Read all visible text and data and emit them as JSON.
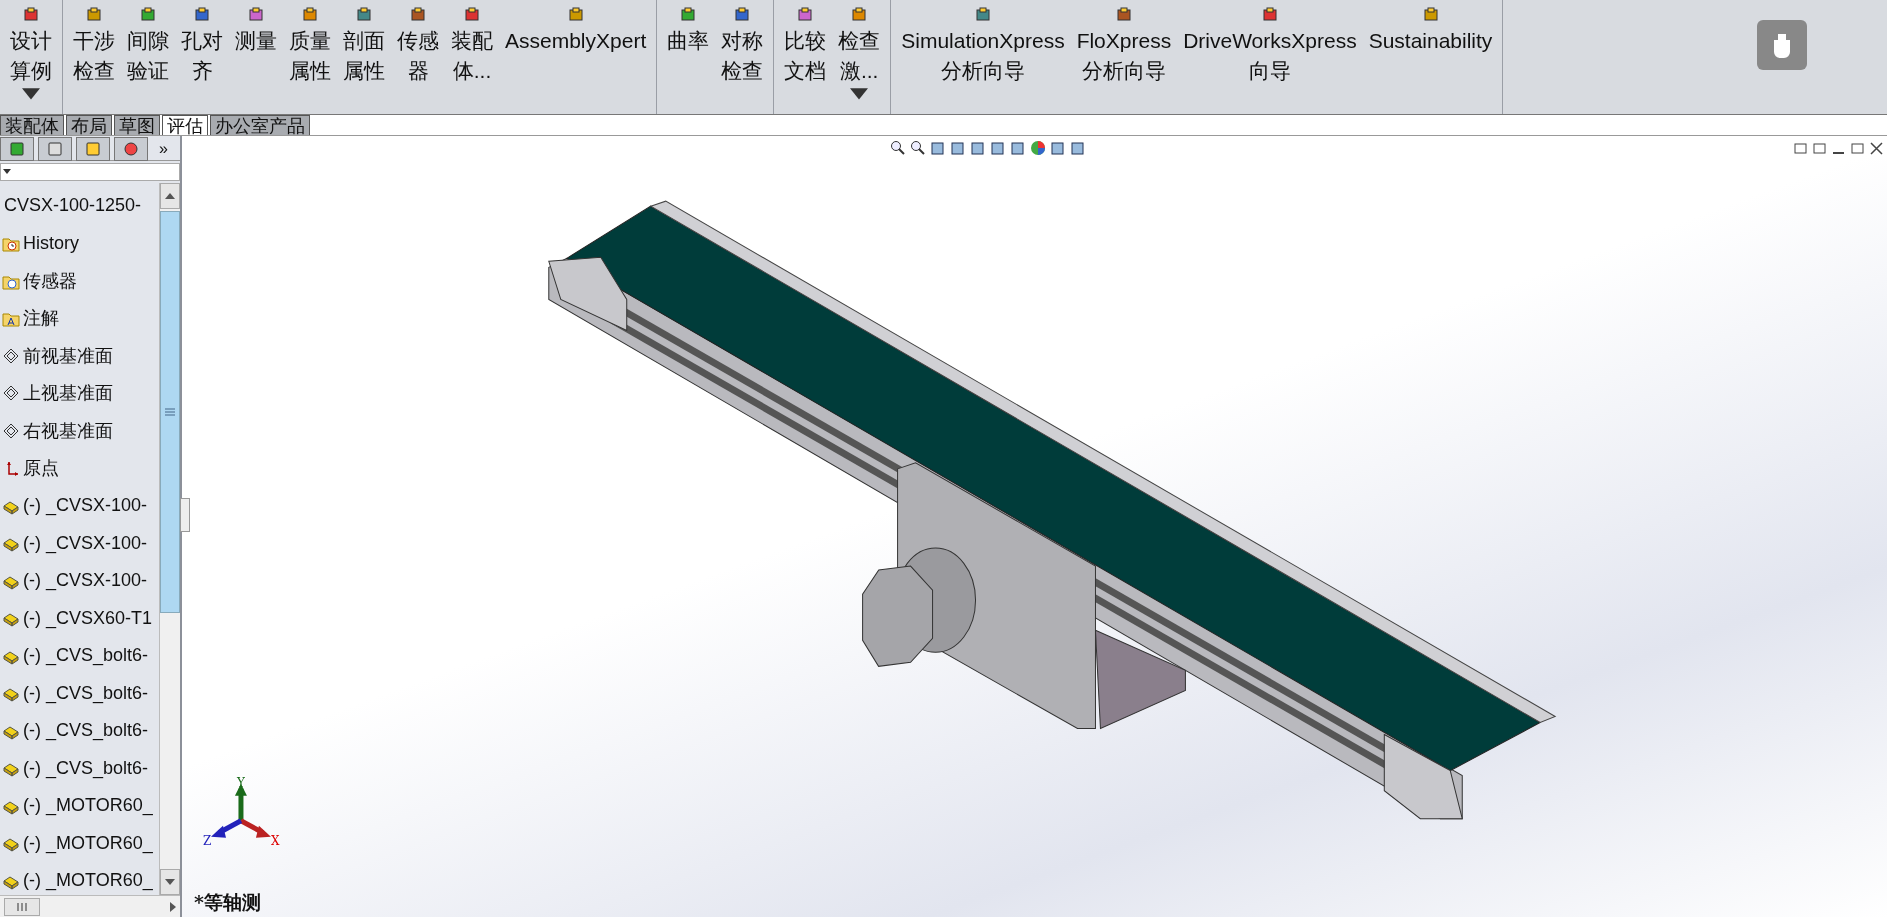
{
  "ribbon": {
    "groups": [
      [
        {
          "lines": [
            "设计",
            "算例"
          ],
          "menu": true
        }
      ],
      [
        {
          "lines": [
            "干涉",
            "检查"
          ],
          "menu": false
        },
        {
          "lines": [
            "间隙",
            "验证"
          ],
          "menu": false
        },
        {
          "lines": [
            "孔对",
            "齐"
          ],
          "menu": false
        },
        {
          "lines": [
            "测量"
          ],
          "menu": false
        },
        {
          "lines": [
            "质量",
            "属性"
          ],
          "menu": false
        },
        {
          "lines": [
            "剖面",
            "属性"
          ],
          "menu": false
        },
        {
          "lines": [
            "传感",
            "器"
          ],
          "menu": false
        },
        {
          "lines": [
            "装配",
            "体..."
          ],
          "menu": false
        },
        {
          "lines": [
            "AssemblyXpert"
          ],
          "menu": false
        }
      ],
      [
        {
          "lines": [
            "曲率"
          ],
          "menu": false
        },
        {
          "lines": [
            "对称",
            "检查"
          ],
          "menu": false
        }
      ],
      [
        {
          "lines": [
            "比较",
            "文档"
          ],
          "menu": false
        },
        {
          "lines": [
            "检查",
            "激..."
          ],
          "menu": true
        }
      ],
      [
        {
          "lines": [
            "SimulationXpress",
            "分析向导"
          ],
          "menu": false
        },
        {
          "lines": [
            "FloXpress",
            "分析向导"
          ],
          "menu": false
        },
        {
          "lines": [
            "DriveWorksXpress",
            "向导"
          ],
          "menu": false
        },
        {
          "lines": [
            "Sustainability"
          ],
          "menu": false
        }
      ]
    ]
  },
  "tabs": [
    {
      "label": "装配体",
      "selected": false
    },
    {
      "label": "布局",
      "selected": false
    },
    {
      "label": "草图",
      "selected": false
    },
    {
      "label": "评估",
      "selected": true
    },
    {
      "label": "办公室产品",
      "selected": false
    }
  ],
  "panel": {
    "expand": "»",
    "root": "CVSX-100-1250-",
    "items": [
      {
        "kind": "history",
        "label": "History"
      },
      {
        "kind": "sensor",
        "label": "传感器"
      },
      {
        "kind": "annotation",
        "label": "注解"
      },
      {
        "kind": "plane",
        "label": "前视基准面"
      },
      {
        "kind": "plane",
        "label": "上视基准面"
      },
      {
        "kind": "plane",
        "label": "右视基准面"
      },
      {
        "kind": "origin",
        "label": "原点"
      },
      {
        "kind": "part",
        "label": "(-) _CVSX-100-"
      },
      {
        "kind": "part",
        "label": "(-) _CVSX-100-"
      },
      {
        "kind": "part",
        "label": "(-) _CVSX-100-"
      },
      {
        "kind": "part",
        "label": "(-) _CVSX60-T1"
      },
      {
        "kind": "part",
        "label": "(-) _CVS_bolt6-"
      },
      {
        "kind": "part",
        "label": "(-) _CVS_bolt6-"
      },
      {
        "kind": "part",
        "label": "(-) _CVS_bolt6-"
      },
      {
        "kind": "part",
        "label": "(-) _CVS_bolt6-"
      },
      {
        "kind": "part",
        "label": "(-) _MOTOR60_"
      },
      {
        "kind": "part",
        "label": "(-) _MOTOR60_"
      },
      {
        "kind": "part",
        "label": "(-) _MOTOR60_"
      }
    ]
  },
  "viewport": {
    "view_name": "*等轴测",
    "axes": {
      "x": "X",
      "y": "Y",
      "z": "Z"
    }
  }
}
